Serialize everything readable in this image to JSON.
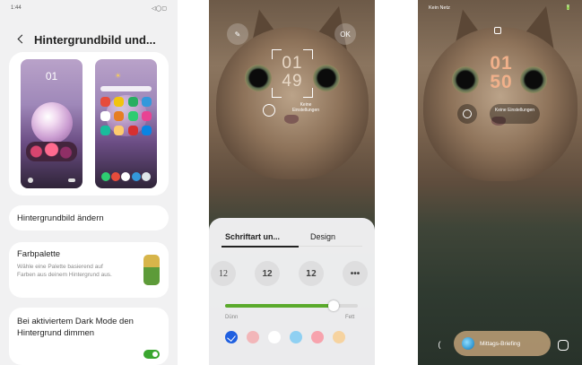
{
  "phone1": {
    "status_time": "1:44",
    "status_icons": "◁◯▢",
    "title": "Hintergrundbild und...",
    "lock_preview_time": "01",
    "change_wallpaper_label": "Hintergrundbild ändern",
    "palette_title": "Farbpalette",
    "palette_desc": "Wähle eine Palette basierend auf Farben aus deinem Hintergrund aus.",
    "dark_mode_label": "Bei aktiviertem Dark Mode den Hintergrund dimmen",
    "dark_mode_enabled": true,
    "colors": {
      "accent": "#3aa62f",
      "card": "#ffffff",
      "bg": "#f1f1f2"
    }
  },
  "phone2": {
    "top_left_icon": "edit-icon",
    "top_right_label": "OK",
    "clock_hours": "01",
    "clock_minutes": "49",
    "widget_text": "Keine Einstellungen",
    "tabs": [
      {
        "label": "Schriftart un..."
      },
      {
        "label": "Design"
      }
    ],
    "font_options": [
      "12",
      "12",
      "12",
      "•••"
    ],
    "thickness_min_label": "Dünn",
    "thickness_max_label": "Fett",
    "thickness_value": 0.82,
    "color_options": [
      {
        "color": "#1f5fe0",
        "selected": true
      },
      {
        "color": "#f2b6b9",
        "selected": false
      },
      {
        "color": "#ffffff",
        "selected": false
      },
      {
        "color": "#8fd0f2",
        "selected": false
      },
      {
        "color": "#f7a3ad",
        "selected": false
      },
      {
        "color": "#f6d3a0",
        "selected": false
      }
    ]
  },
  "phone3": {
    "status_left": "Kein Netz",
    "status_right": "🔋",
    "clock_hours": "01",
    "clock_minutes": "50",
    "widget_text": "Keine Einstellungen",
    "briefing_label": "Mittags-Briefing"
  }
}
